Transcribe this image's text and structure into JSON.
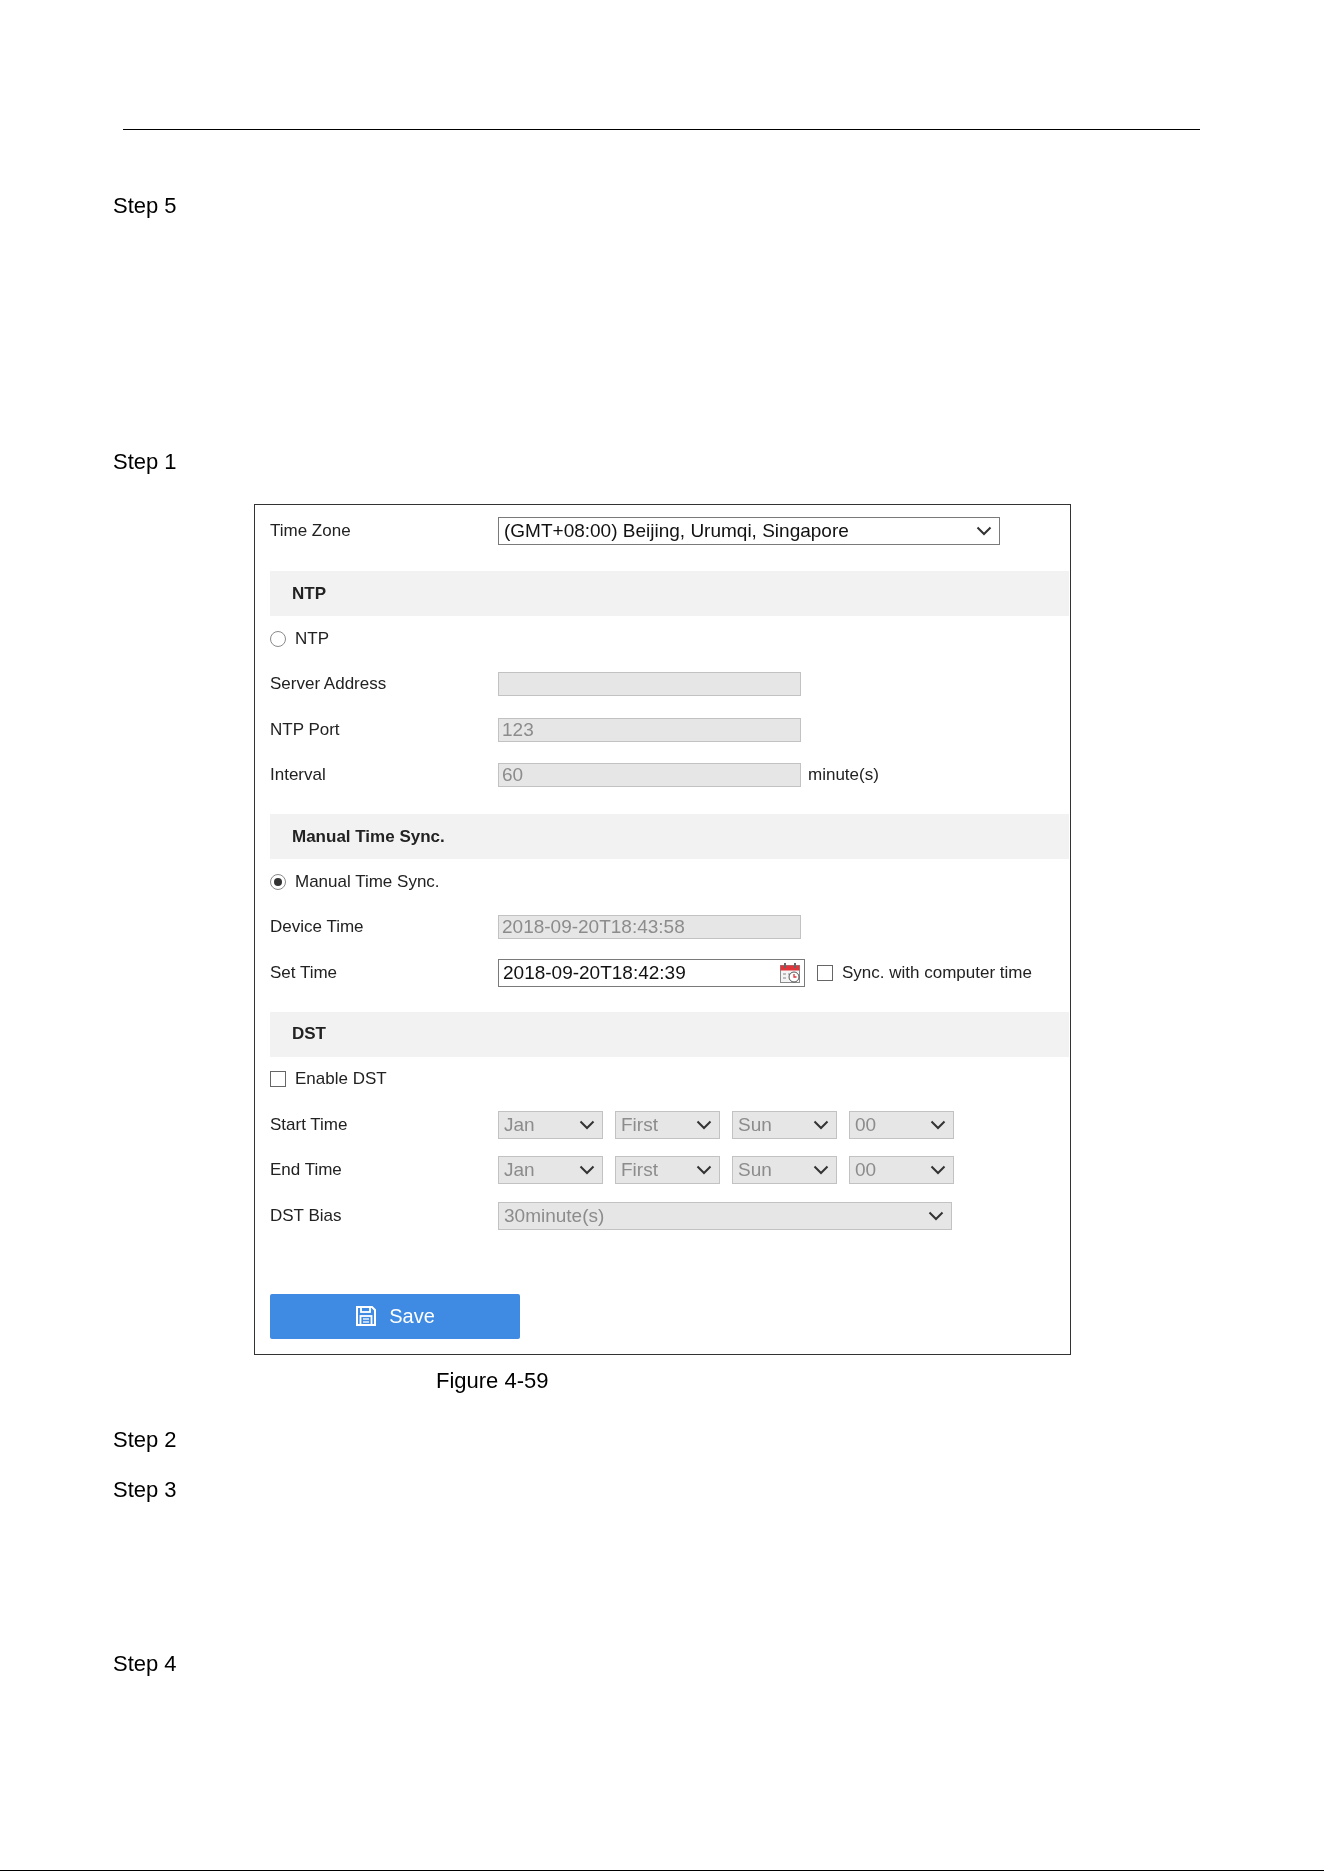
{
  "steps_before": [
    "Step 5",
    "Step 1"
  ],
  "figure": {
    "time_zone": {
      "label": "Time Zone",
      "value": "(GMT+08:00) Beijing, Urumqi, Singapore",
      "disabled": false
    },
    "sections": [
      {
        "title": "NTP",
        "rows": [
          {
            "kind": "radio",
            "label": "NTP",
            "selected": false
          },
          {
            "kind": "field",
            "label": "Server Address",
            "disabled": true
          },
          {
            "kind": "field",
            "label": "NTP Port",
            "value": "123",
            "disabled": true
          },
          {
            "kind": "field",
            "label": "Interval",
            "value": "60",
            "unit": "minute(s)",
            "disabled": true
          }
        ]
      },
      {
        "title": "Manual Time Sync.",
        "rows": [
          {
            "kind": "radio",
            "label": "Manual Time Sync.",
            "selected": true
          },
          {
            "kind": "field",
            "label": "Device Time",
            "value": "2018-09-20T18:43:58",
            "disabled": true
          },
          {
            "kind": "datetime",
            "label": "Set Time",
            "value": "2018-09-20T18:42:39",
            "disabled": false,
            "option": {
              "label": "Sync. with computer time",
              "checked": false
            }
          }
        ]
      },
      {
        "title": "DST",
        "rows": [
          {
            "kind": "checkbox",
            "label": "Enable DST",
            "checked": false
          },
          {
            "kind": "select_group",
            "label": "Start Time",
            "values": [
              "Jan",
              "First",
              "Sun",
              "00"
            ],
            "disabled": true
          },
          {
            "kind": "select_group",
            "label": "End Time",
            "values": [
              "Jan",
              "First",
              "Sun",
              "00"
            ],
            "disabled": true
          },
          {
            "kind": "select",
            "label": "DST Bias",
            "value": "30minute(s)",
            "disabled": true
          }
        ]
      }
    ],
    "save_button": {
      "label": "Save"
    }
  },
  "caption": "Figure 4-59",
  "steps_after": [
    "Step 2",
    "Step 3",
    "Step 4"
  ]
}
